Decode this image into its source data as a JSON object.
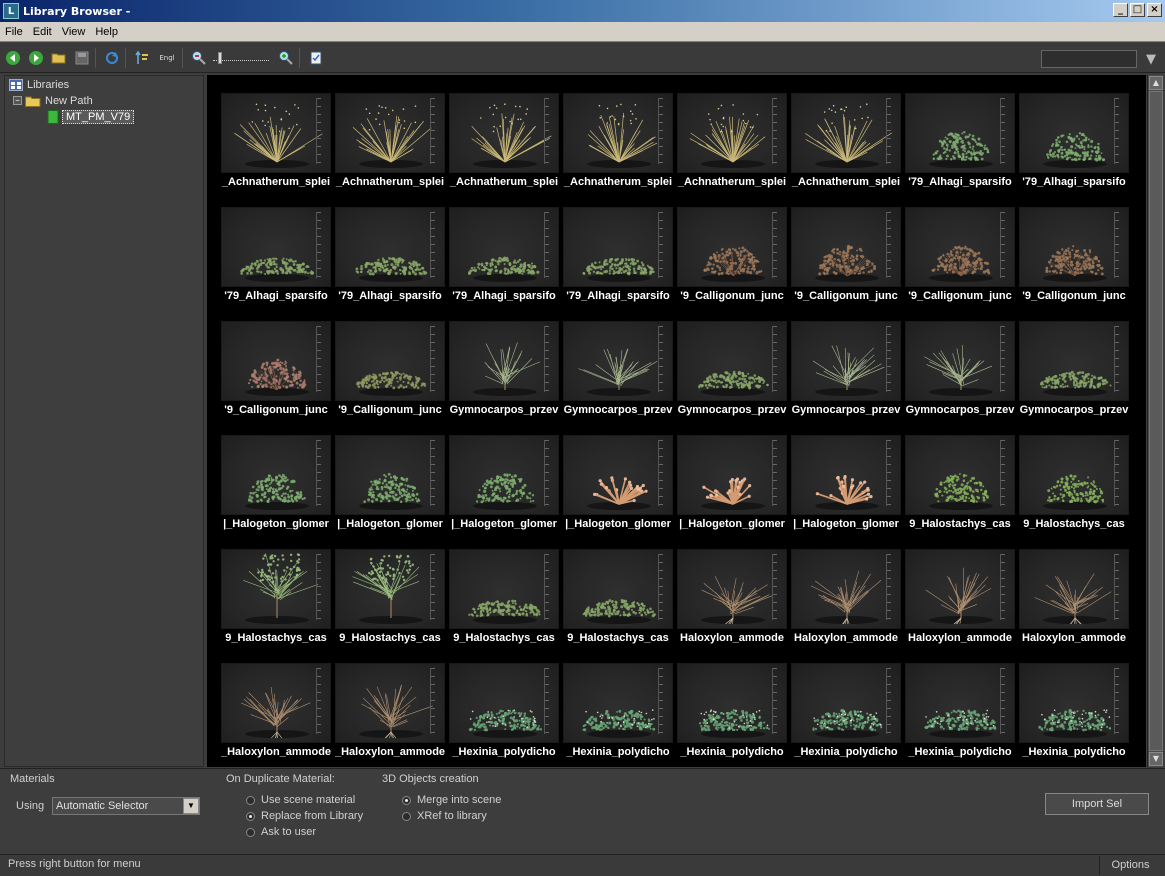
{
  "window": {
    "title": "Library Browser -",
    "min": "_",
    "max": "□",
    "close": "×"
  },
  "menu": [
    "File",
    "Edit",
    "View",
    "Help"
  ],
  "toolbar": {
    "engl_label": "Engl"
  },
  "tree": {
    "root_label": "Libraries",
    "path_label": "New Path",
    "lib_label": "MT_PM_V79",
    "expander": "−"
  },
  "zoom": {
    "level": 0.1
  },
  "grid": {
    "columns": 8,
    "items": [
      {
        "label": "_Achnatherum_splei",
        "plant": "grass"
      },
      {
        "label": "_Achnatherum_splei",
        "plant": "grass"
      },
      {
        "label": "_Achnatherum_splei",
        "plant": "grass"
      },
      {
        "label": "_Achnatherum_splei",
        "plant": "grass"
      },
      {
        "label": "_Achnatherum_splei",
        "plant": "grass"
      },
      {
        "label": "_Achnatherum_splei",
        "plant": "grass"
      },
      {
        "label": "'79_Alhagi_sparsifo",
        "plant": "greenbush"
      },
      {
        "label": "'79_Alhagi_sparsifo",
        "plant": "greenbush"
      },
      {
        "label": "'79_Alhagi_sparsifo",
        "plant": "lowgreen"
      },
      {
        "label": "'79_Alhagi_sparsifo",
        "plant": "lowgreen"
      },
      {
        "label": "'79_Alhagi_sparsifo",
        "plant": "lowgreen"
      },
      {
        "label": "'79_Alhagi_sparsifo",
        "plant": "lowgreen"
      },
      {
        "label": "'9_Calligonum_junc",
        "plant": "brownshrub"
      },
      {
        "label": "'9_Calligonum_junc",
        "plant": "brownshrub"
      },
      {
        "label": "'9_Calligonum_junc",
        "plant": "brownshrub"
      },
      {
        "label": "'9_Calligonum_junc",
        "plant": "brownshrub"
      },
      {
        "label": "'9_Calligonum_junc",
        "plant": "pinkshrub"
      },
      {
        "label": "'9_Calligonum_junc",
        "plant": "lowolive"
      },
      {
        "label": "Gymnocarpos_przev",
        "plant": "twiggy"
      },
      {
        "label": "Gymnocarpos_przev",
        "plant": "twiggy"
      },
      {
        "label": "Gymnocarpos_przev",
        "plant": "lowgreen"
      },
      {
        "label": "Gymnocarpos_przev",
        "plant": "twiggy"
      },
      {
        "label": "Gymnocarpos_przev",
        "plant": "twiggy"
      },
      {
        "label": "Gymnocarpos_przev",
        "plant": "lowgreen"
      },
      {
        "label": "|_Halogeton_glomer",
        "plant": "greenbush"
      },
      {
        "label": "|_Halogeton_glomer",
        "plant": "greenbush"
      },
      {
        "label": "|_Halogeton_glomer",
        "plant": "greenbush"
      },
      {
        "label": "|_Halogeton_glomer",
        "plant": "coral"
      },
      {
        "label": "|_Halogeton_glomer",
        "plant": "coral"
      },
      {
        "label": "|_Halogeton_glomer",
        "plant": "coral"
      },
      {
        "label": "9_Halostachys_cas",
        "plant": "roundgreen"
      },
      {
        "label": "9_Halostachys_cas",
        "plant": "roundgreen"
      },
      {
        "label": "9_Halostachys_cas",
        "plant": "tree"
      },
      {
        "label": "9_Halostachys_cas",
        "plant": "tree"
      },
      {
        "label": "9_Halostachys_cas",
        "plant": "lowgreen"
      },
      {
        "label": "9_Halostachys_cas",
        "plant": "lowgreen"
      },
      {
        "label": "Haloxylon_ammode",
        "plant": "bare"
      },
      {
        "label": "Haloxylon_ammode",
        "plant": "bare"
      },
      {
        "label": "Haloxylon_ammode",
        "plant": "bare"
      },
      {
        "label": "Haloxylon_ammode",
        "plant": "bare"
      },
      {
        "label": "_Haloxylon_ammode",
        "plant": "bare"
      },
      {
        "label": "_Haloxylon_ammode",
        "plant": "bare"
      },
      {
        "label": "_Hexinia_polydicho",
        "plant": "mound"
      },
      {
        "label": "_Hexinia_polydicho",
        "plant": "mound"
      },
      {
        "label": "_Hexinia_polydicho",
        "plant": "mound"
      },
      {
        "label": "_Hexinia_polydicho",
        "plant": "mound"
      },
      {
        "label": "_Hexinia_polydicho",
        "plant": "mound"
      },
      {
        "label": "_Hexinia_polydicho",
        "plant": "mound"
      }
    ]
  },
  "plant_colors": {
    "grass": "#c9b878",
    "greenbush": "#7fb070",
    "lowgreen": "#8aa868",
    "brownshrub": "#a07a5a",
    "pinkshrub": "#b08070",
    "lowolive": "#8f9a60",
    "twiggy": "#a8b890",
    "coral": "#d49a72",
    "roundgreen": "#86b15a",
    "tree": "#9cc080",
    "bare": "#b09070",
    "mound": "#6aa878"
  },
  "materials": {
    "section_label": "Materials",
    "using_label": "Using",
    "using_value": "Automatic Selector"
  },
  "duplicate": {
    "section_label": "On Duplicate Material:",
    "options": [
      {
        "label": "Use scene material",
        "selected": false
      },
      {
        "label": "Replace from Library",
        "selected": true
      },
      {
        "label": "Ask to user",
        "selected": false
      }
    ]
  },
  "objects": {
    "section_label": "3D Objects creation",
    "options": [
      {
        "label": "Merge into scene",
        "selected": true
      },
      {
        "label": "XRef to library",
        "selected": false
      }
    ]
  },
  "import_button": "Import Sel",
  "status": {
    "text": "Press right button for menu",
    "options_label": "Options"
  }
}
